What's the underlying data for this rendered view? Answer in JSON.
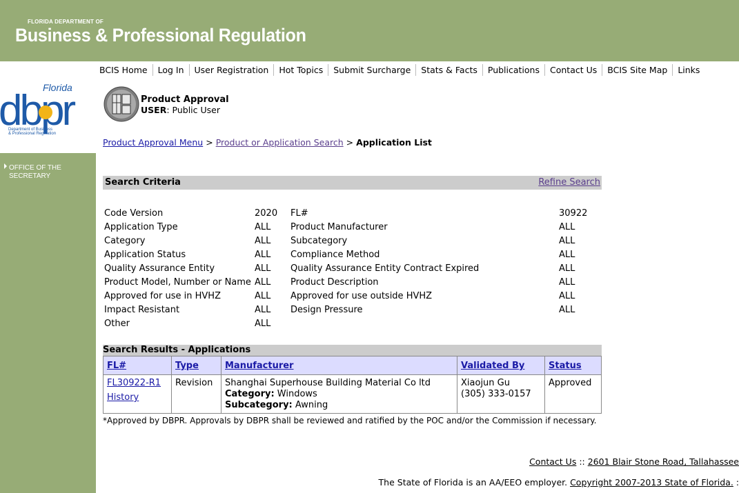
{
  "header": {
    "dept_small": "FLORIDA DEPARTMENT OF",
    "dept_big": "Business & Professional Regulation"
  },
  "topnav": [
    "BCIS Home",
    "Log In",
    "User Registration",
    "Hot Topics",
    "Submit Surcharge",
    "Stats & Facts",
    "Publications",
    "Contact Us",
    "BCIS Site Map",
    "Links"
  ],
  "logo": {
    "state": "Florida",
    "letters": "dbpr",
    "subtitle1": "Department of Business",
    "subtitle2": "& Professional Regulation"
  },
  "sidebar": {
    "office_line1": "OFFICE OF THE",
    "office_line2": "SECRETARY"
  },
  "product_approval": {
    "title": "Product Approval",
    "user_label": "USER",
    "user_value": ": Public User"
  },
  "breadcrumb": {
    "link1": "Product Approval Menu",
    "link2": "Product or Application Search",
    "current": "Application List",
    "sep": ">"
  },
  "criteria": {
    "title": "Search Criteria",
    "refine_label": "Refine Search",
    "rows": [
      {
        "l_label": "Code Version",
        "l_value": "2020",
        "r_label": "FL#",
        "r_value": "30922"
      },
      {
        "l_label": "Application Type",
        "l_value": "ALL",
        "r_label": "Product Manufacturer",
        "r_value": "ALL"
      },
      {
        "l_label": "Category",
        "l_value": "ALL",
        "r_label": "Subcategory",
        "r_value": "ALL"
      },
      {
        "l_label": "Application Status",
        "l_value": "ALL",
        "r_label": "Compliance Method",
        "r_value": "ALL"
      },
      {
        "l_label": "Quality Assurance Entity",
        "l_value": "ALL",
        "r_label": "Quality Assurance Entity Contract Expired",
        "r_value": "ALL"
      },
      {
        "l_label": "Product Model, Number or Name",
        "l_value": "ALL",
        "r_label": "Product Description",
        "r_value": "ALL"
      },
      {
        "l_label": "Approved for use in HVHZ",
        "l_value": "ALL",
        "r_label": "Approved for use outside HVHZ",
        "r_value": "ALL"
      },
      {
        "l_label": "Impact Resistant",
        "l_value": "ALL",
        "r_label": "Design Pressure",
        "r_value": "ALL"
      },
      {
        "l_label": "Other",
        "l_value": "ALL",
        "r_label": "",
        "r_value": ""
      }
    ]
  },
  "results": {
    "title": "Search Results - Applications",
    "columns": {
      "fl": "FL#",
      "type": "Type",
      "manufacturer": "Manufacturer",
      "validated_by": "Validated By",
      "status": "Status"
    },
    "row": {
      "fl_link": "FL30922-R1",
      "history_link": "History",
      "type": "Revision",
      "manufacturer": "Shanghai Superhouse Building Material Co ltd",
      "category_label": "Category:",
      "category_value": " Windows",
      "subcategory_label": "Subcategory:",
      "subcategory_value": " Awning",
      "validator_name": "Xiaojun Gu",
      "validator_phone": "(305) 333-0157",
      "status": "Approved"
    }
  },
  "note": "*Approved by DBPR. Approvals by DBPR shall be reviewed and ratified by the POC and/or the Commission if necessary.",
  "footer": {
    "contact": "Contact Us",
    "sep": " :: ",
    "address": "2601 Blair Stone Road, Tallahassee",
    "employer": "The State of Florida is an AA/EEO employer. ",
    "copyright": "Copyright 2007-2013 State of Florida.",
    "tail": " :"
  },
  "colors": {
    "header_green": "#97ac76",
    "table_header": "#dcdcff",
    "section_gray": "#cccccc",
    "logo_blue": "#1e5aa8"
  }
}
